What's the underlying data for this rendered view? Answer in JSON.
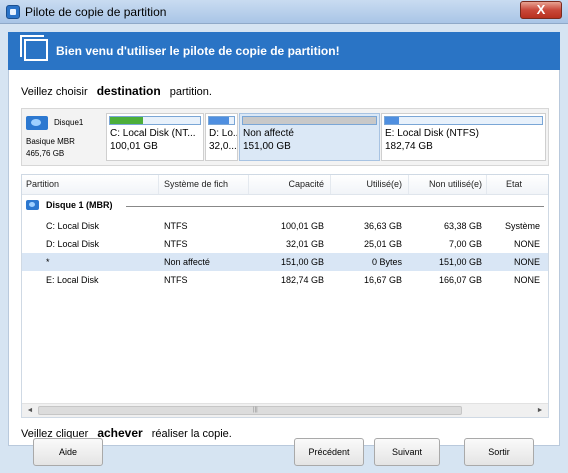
{
  "window": {
    "title": "Pilote de copie de partition",
    "close_label": "X"
  },
  "banner": {
    "text": "Bien venu d'utiliser le pilote de copie de partition!"
  },
  "instruction_top": {
    "prefix": "Veillez choisir",
    "emphasis": "destination",
    "suffix": "partition."
  },
  "disk_map": {
    "disk_name": "Disque1",
    "disk_type": "Basique MBR",
    "disk_size": "465,76 GB",
    "partitions": [
      {
        "name": "C: Local Disk (NT...",
        "size": "100,01 GB",
        "used_fraction": 0.37,
        "fill_color": "#4cae3a"
      },
      {
        "name": "D: Lo...",
        "size": "32,0...",
        "used_fraction": 0.78,
        "fill_color": "#4f8fe0"
      },
      {
        "name": "Non affecté",
        "size": "151,00 GB",
        "used_fraction": 1.0,
        "fill_color": "#c8c8c8"
      },
      {
        "name": "E: Local Disk (NTFS)",
        "size": "182,74 GB",
        "used_fraction": 0.09,
        "fill_color": "#4f8fe0"
      }
    ]
  },
  "table": {
    "columns": [
      "Partition",
      "Système de fich",
      "Capacité",
      "Utilisé(e)",
      "Non utilisé(e)",
      "Etat"
    ],
    "group_label": "Disque 1 (MBR)",
    "rows": [
      {
        "partition": "C: Local Disk",
        "fs": "NTFS",
        "capacity": "100,01 GB",
        "used": "36,63 GB",
        "unused": "63,38 GB",
        "state": "Système"
      },
      {
        "partition": "D: Local Disk",
        "fs": "NTFS",
        "capacity": "32,01 GB",
        "used": "25,01 GB",
        "unused": "7,00 GB",
        "state": "NONE"
      },
      {
        "partition": "*",
        "fs": "Non affecté",
        "capacity": "151,00 GB",
        "used": "0 Bytes",
        "unused": "151,00 GB",
        "state": "NONE"
      },
      {
        "partition": "E: Local Disk",
        "fs": "NTFS",
        "capacity": "182,74 GB",
        "used": "16,67 GB",
        "unused": "166,07 GB",
        "state": "NONE"
      }
    ],
    "scroll_left": "◄",
    "scroll_right": "►",
    "scroll_grip": "|||"
  },
  "instruction_bottom": {
    "prefix": "Veillez cliquer",
    "emphasis": "achever",
    "suffix": "réaliser la copie."
  },
  "buttons": {
    "help": "Aide",
    "previous": "Précédent",
    "next": "Suivant",
    "exit": "Sortir"
  }
}
